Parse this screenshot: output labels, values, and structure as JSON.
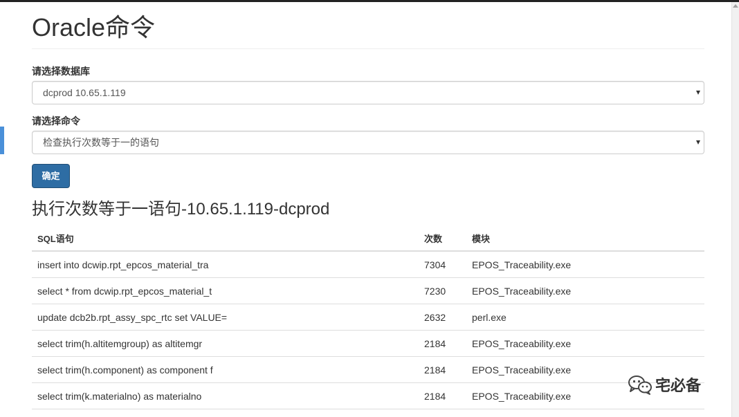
{
  "page": {
    "title": "Oracle命令"
  },
  "form": {
    "database_label": "请选择数据库",
    "database_value": "dcprod 10.65.1.119",
    "command_label": "请选择命令",
    "command_value": "检查执行次数等于一的语句",
    "submit_label": "确定"
  },
  "result": {
    "title": "执行次数等于一语句-10.65.1.119-dcprod",
    "headers": {
      "sql": "SQL语句",
      "count": "次数",
      "module": "模块"
    },
    "rows": [
      {
        "sql": "insert into dcwip.rpt_epcos_material_tra",
        "count": "7304",
        "module": "EPOS_Traceability.exe"
      },
      {
        "sql": "select * from dcwip.rpt_epcos_material_t",
        "count": "7230",
        "module": "EPOS_Traceability.exe"
      },
      {
        "sql": "update dcb2b.rpt_assy_spc_rtc set VALUE=",
        "count": "2632",
        "module": "perl.exe"
      },
      {
        "sql": "select trim(h.altitemgroup) as altitemgr",
        "count": "2184",
        "module": "EPOS_Traceability.exe"
      },
      {
        "sql": "select trim(h.component) as component f",
        "count": "2184",
        "module": "EPOS_Traceability.exe"
      },
      {
        "sql": "select trim(k.materialno) as materialno",
        "count": "2184",
        "module": "EPOS_Traceability.exe"
      }
    ]
  },
  "watermark": {
    "text": "宅必备",
    "icon": "wechat-icon"
  },
  "colors": {
    "primary_button": "#2e6da4",
    "left_tab": "#4a90d9"
  }
}
